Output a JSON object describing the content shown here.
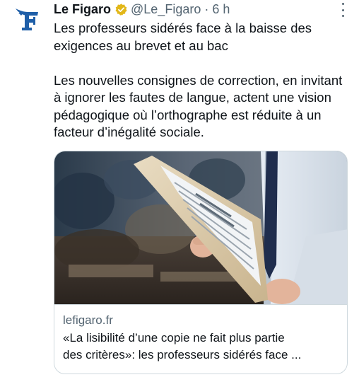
{
  "author": {
    "name": "Le Figaro",
    "handle": "@Le_Figaro",
    "separator": "·",
    "time": "6 h",
    "verified_color": "#e2b719",
    "logo_color": "#1f5fa8"
  },
  "icons": {
    "avatar": "le-figaro-logo",
    "badge": "verified-badge-icon",
    "more": "more-options-icon"
  },
  "tweet": {
    "paragraph1": "Les professeurs sidérés face à la baisse des exigences au brevet et au bac",
    "paragraph2": "Les nouvelles consignes de correction, en invitant à ignorer les fautes de langue, actent une vision pédagogique où l’orthographe est réduite à un facteur d’inégalité sociale."
  },
  "card": {
    "image_description_icon": "teacher-holding-exam-papers-photo",
    "domain": "lefigaro.fr",
    "title_line1": "«La lisibilité d’une copie ne fait plus partie",
    "title_line2": "des critères»: les professeurs sidérés face ..."
  }
}
